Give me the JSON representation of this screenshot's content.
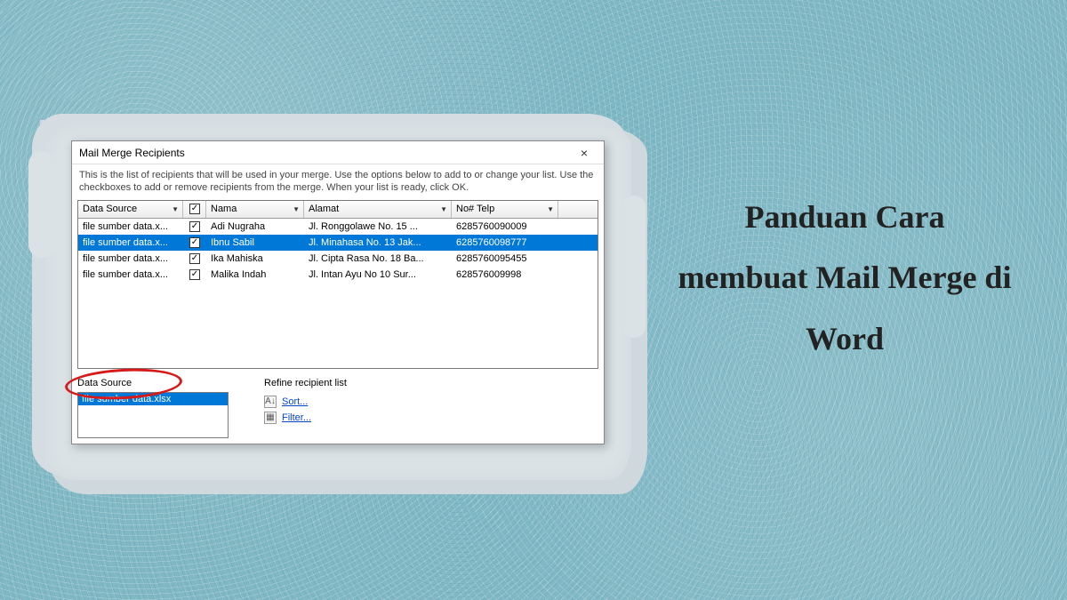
{
  "side_title": "Panduan Cara membuat Mail Merge di Word",
  "dialog": {
    "title": "Mail Merge Recipients",
    "close": "×",
    "instructions": "This is the list of recipients that will be used in your merge.  Use the options below to add to or change your list.  Use the checkboxes to add or remove recipients from the merge.  When your list is ready, click OK.",
    "columns": {
      "data_source": "Data Source",
      "nama": "Nama",
      "alamat": "Alamat",
      "telp": "No# Telp"
    },
    "rows": [
      {
        "ds": "file sumber data.x...",
        "checked": true,
        "nama": "Adi Nugraha",
        "alamat": "Jl. Ronggolawe No. 15 ...",
        "telp": "6285760090009",
        "selected": false
      },
      {
        "ds": "file sumber data.x...",
        "checked": true,
        "nama": "Ibnu Sabil",
        "alamat": "Jl. Minahasa No. 13 Jak...",
        "telp": "6285760098777",
        "selected": true
      },
      {
        "ds": "file sumber data.x...",
        "checked": true,
        "nama": "Ika Mahiska",
        "alamat": "Jl. Cipta Rasa No. 18 Ba...",
        "telp": "6285760095455",
        "selected": false
      },
      {
        "ds": "file sumber data.x...",
        "checked": true,
        "nama": "Malika Indah",
        "alamat": "Jl. Intan Ayu No 10 Sur...",
        "telp": "628576009998",
        "selected": false
      }
    ],
    "data_source_panel": {
      "label": "Data Source",
      "item": "file sumber data.xlsx"
    },
    "refine": {
      "label": "Refine recipient list",
      "sort": "Sort...",
      "filter": "Filter..."
    }
  }
}
